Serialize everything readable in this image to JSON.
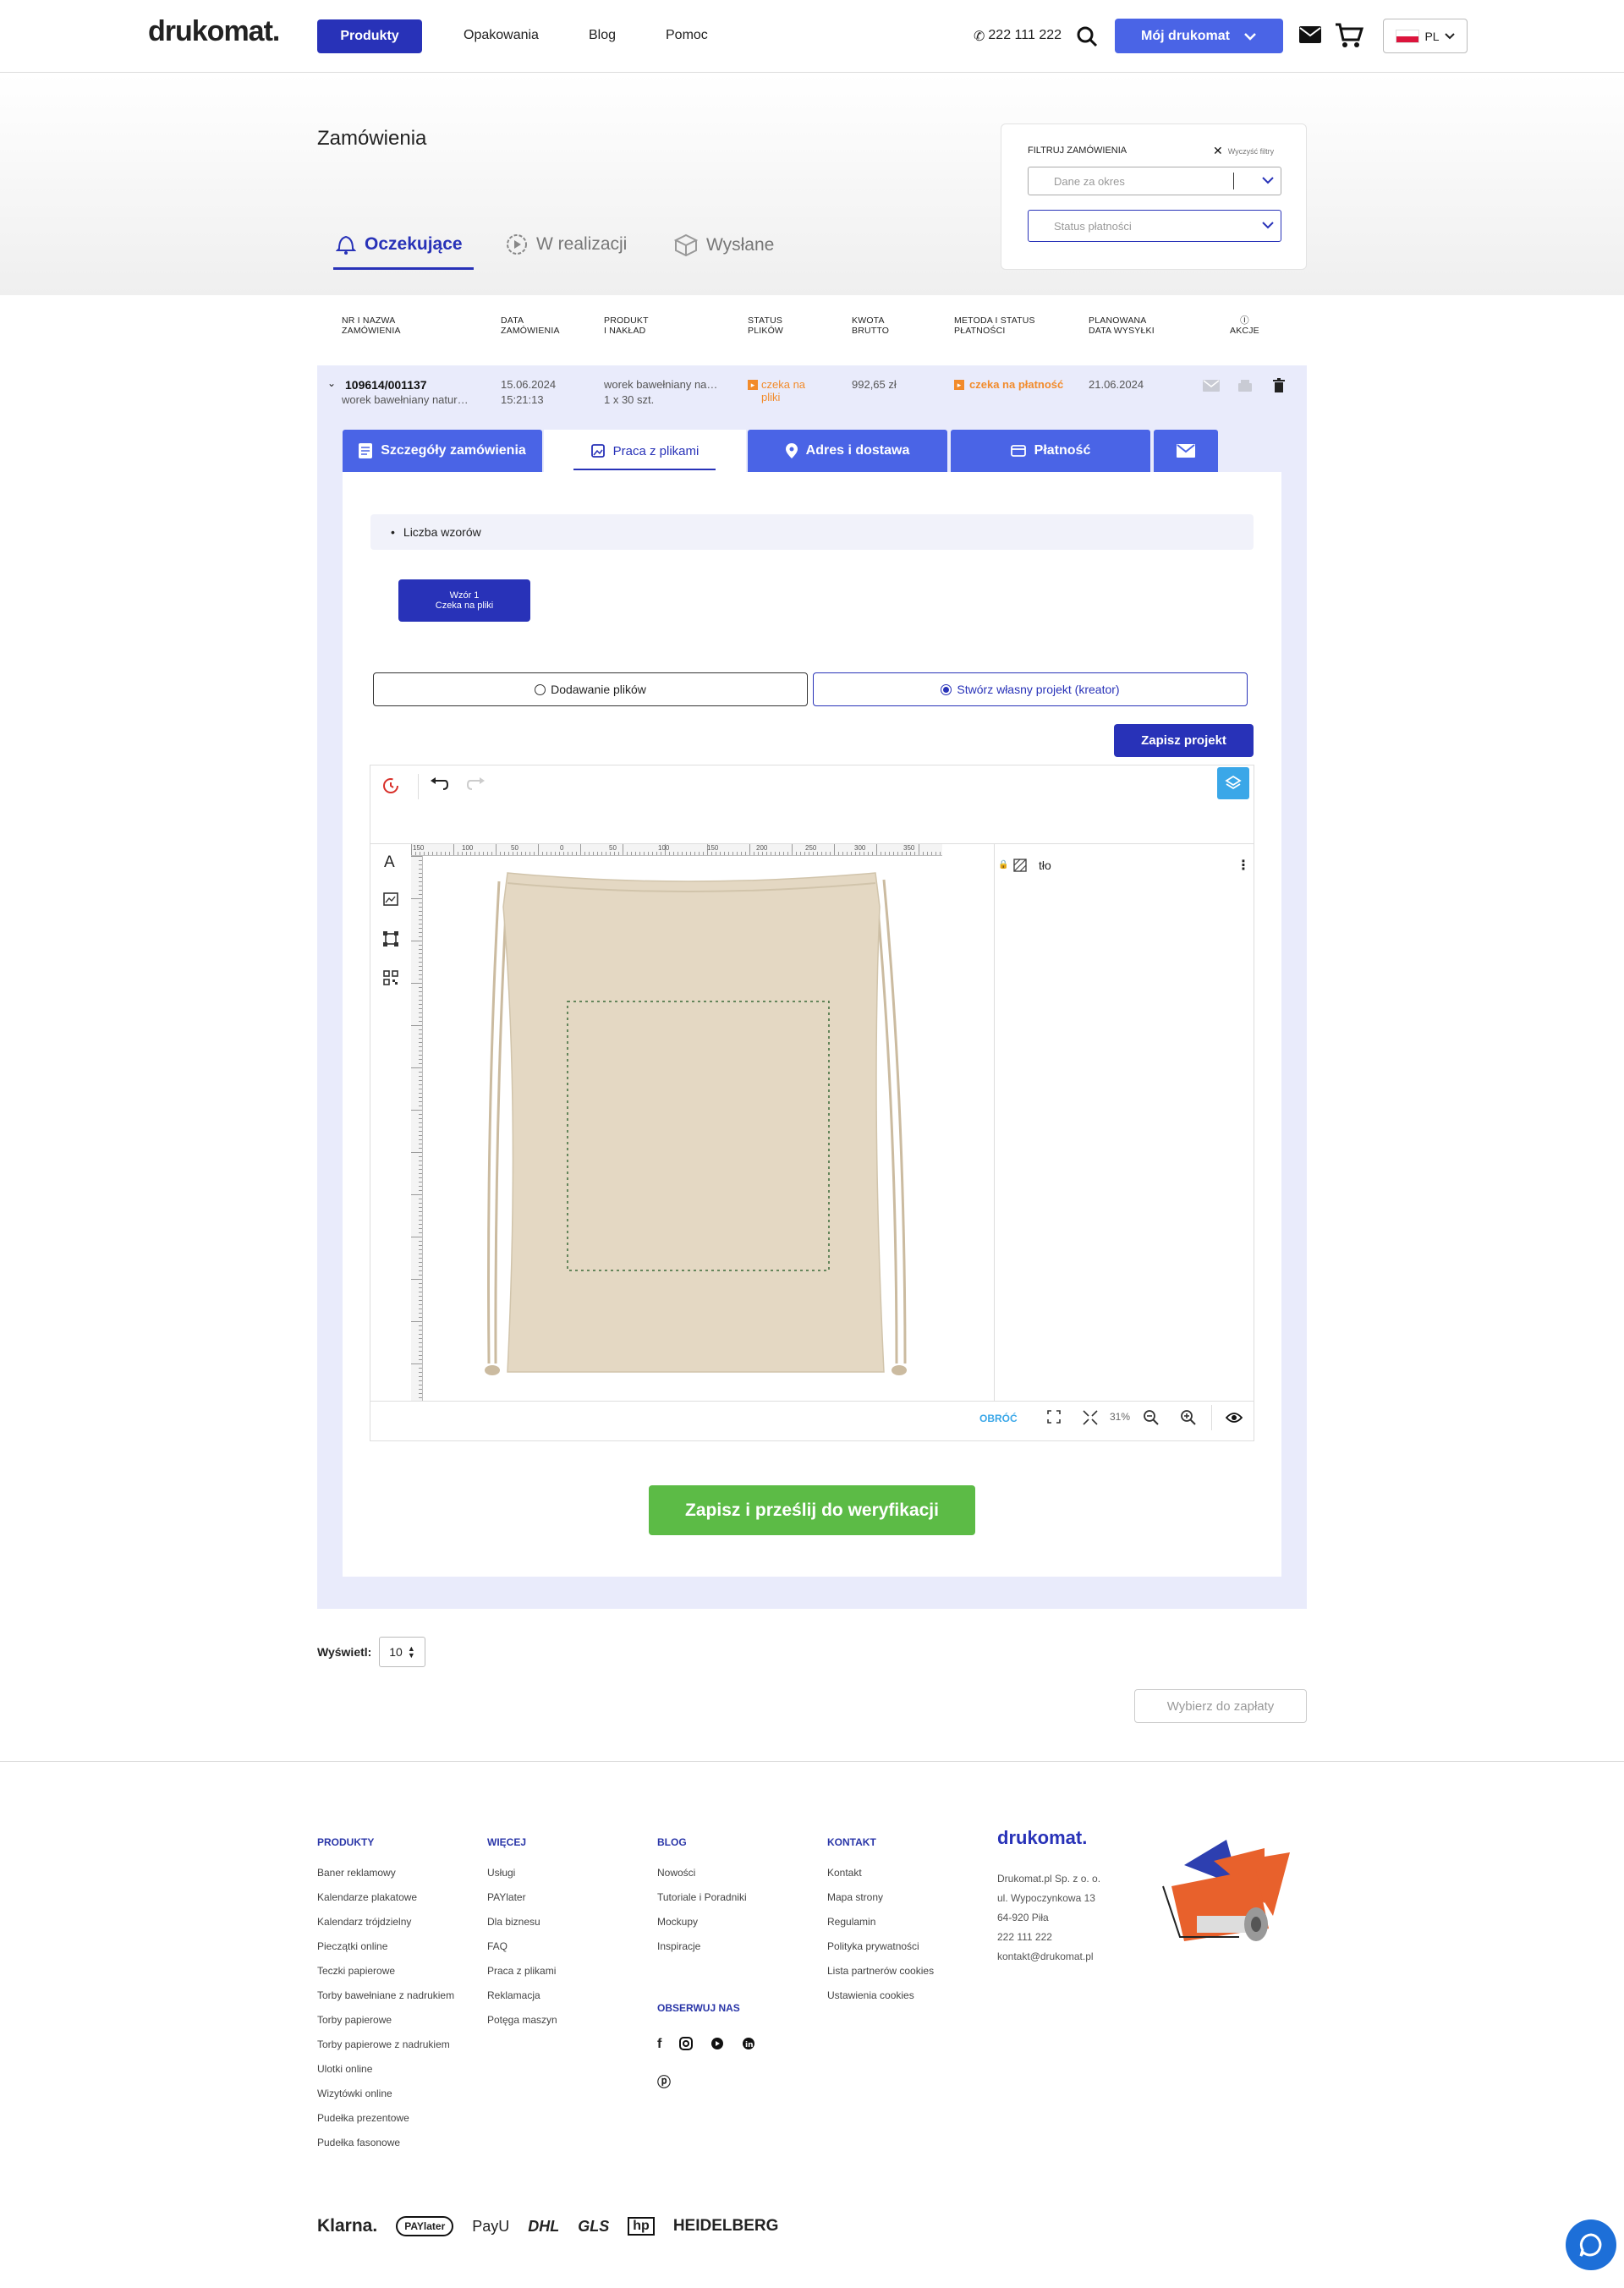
{
  "header": {
    "logo": "drukomat.",
    "nav_active": "Produkty",
    "nav": [
      "Opakowania",
      "Blog",
      "Pomoc"
    ],
    "phone": "222 111 222",
    "account_button": "Mój drukomat",
    "language": "PL",
    "accent": "#2832b8"
  },
  "page": {
    "title": "Zamówienia",
    "tabs": [
      "Oczekujące",
      "W realizacji",
      "Wysłane"
    ],
    "filter": {
      "title": "FILTRUJ ZAMÓWIENIA",
      "clear": "Wyczyść filtry",
      "period_placeholder": "Dane za okres",
      "payment_placeholder": "Status płatności"
    }
  },
  "table": {
    "headers": [
      [
        "NR I NAZWA",
        "ZAMÓWIENIA"
      ],
      [
        "DATA",
        "ZAMÓWIENIA"
      ],
      [
        "PRODUKT",
        "I NAKŁAD"
      ],
      [
        "STATUS",
        "PLIKÓW"
      ],
      [
        "KWOTA",
        "BRUTTO"
      ],
      [
        "METODA I STATUS",
        "PŁATNOŚCI"
      ],
      [
        "PLANOWANA",
        "DATA WYSYŁKI"
      ],
      [
        "",
        "AKCJE"
      ]
    ],
    "order": {
      "number": "109614/001137",
      "name": "worek bawełniany natur…",
      "date": "15.06.2024",
      "time": "15:21:13",
      "product": "worek bawełniany na…",
      "quantity": "1 x 30 szt.",
      "file_status": [
        "czeka na",
        "pliki"
      ],
      "amount": "992,65 zł",
      "payment_status": "czeka na płatność",
      "ship_date": "21.06.2024"
    }
  },
  "order_tabs": [
    "Szczegóły zamówienia",
    "Praca z plikami",
    "Adres i dostawa",
    "Płatność"
  ],
  "files": {
    "designs_label": "Liczba wzorów",
    "design_button": [
      "Wzór 1",
      "Czeka na pliki"
    ],
    "option_upload": "Dodawanie plików",
    "option_creator": "Stwórz własny projekt (kreator)",
    "save_project": "Zapisz projekt",
    "layer_name": "tło",
    "rotate": "OBRÓĆ",
    "zoom": "31%",
    "submit": "Zapisz i prześlij do weryfikacji",
    "ruler_top": [
      "150",
      "100",
      "50",
      "0",
      "50",
      "100",
      "150",
      "200",
      "250",
      "300",
      "350",
      "400"
    ]
  },
  "pagination": {
    "show_label": "Wyświetl:",
    "per_page": "10",
    "pay_button": "Wybierz do zapłaty"
  },
  "footer": {
    "columns": [
      {
        "title": "PRODUKTY",
        "items": [
          "Baner reklamowy",
          "Kalendarze plakatowe",
          "Kalendarz trójdzielny",
          "Pieczątki online",
          "Teczki papierowe",
          "Torby bawełniane z nadrukiem",
          "Torby papierowe",
          "Torby papierowe z nadrukiem",
          "Ulotki online",
          "Wizytówki online",
          "Pudełka prezentowe",
          "Pudełka fasonowe"
        ]
      },
      {
        "title": "WIĘCEJ",
        "items": [
          "Usługi",
          "PAYlater",
          "Dla biznesu",
          "FAQ",
          "Praca z plikami",
          "Reklamacja",
          "Potęga maszyn"
        ]
      },
      {
        "title": "BLOG",
        "items": [
          "Nowości",
          "Tutoriale i Poradniki",
          "Mockupy",
          "Inspiracje"
        ]
      },
      {
        "title": "KONTAKT",
        "items": [
          "Kontakt",
          "Mapa strony",
          "Regulamin",
          "Polityka prywatności",
          "Lista partnerów cookies",
          "Ustawienia cookies"
        ]
      }
    ],
    "follow": "OBSERWUJ NAS",
    "company_logo": "drukomat.",
    "company": [
      "Drukomat.pl Sp. z o. o.",
      "ul. Wypoczynkowa 13",
      "64-920 Piła",
      "222 111 222",
      "kontakt@drukomat.pl"
    ],
    "partners": [
      "Klarna.",
      "PAYlater",
      "PayU",
      "DHL",
      "GLS",
      "HEIDELBERG"
    ]
  }
}
